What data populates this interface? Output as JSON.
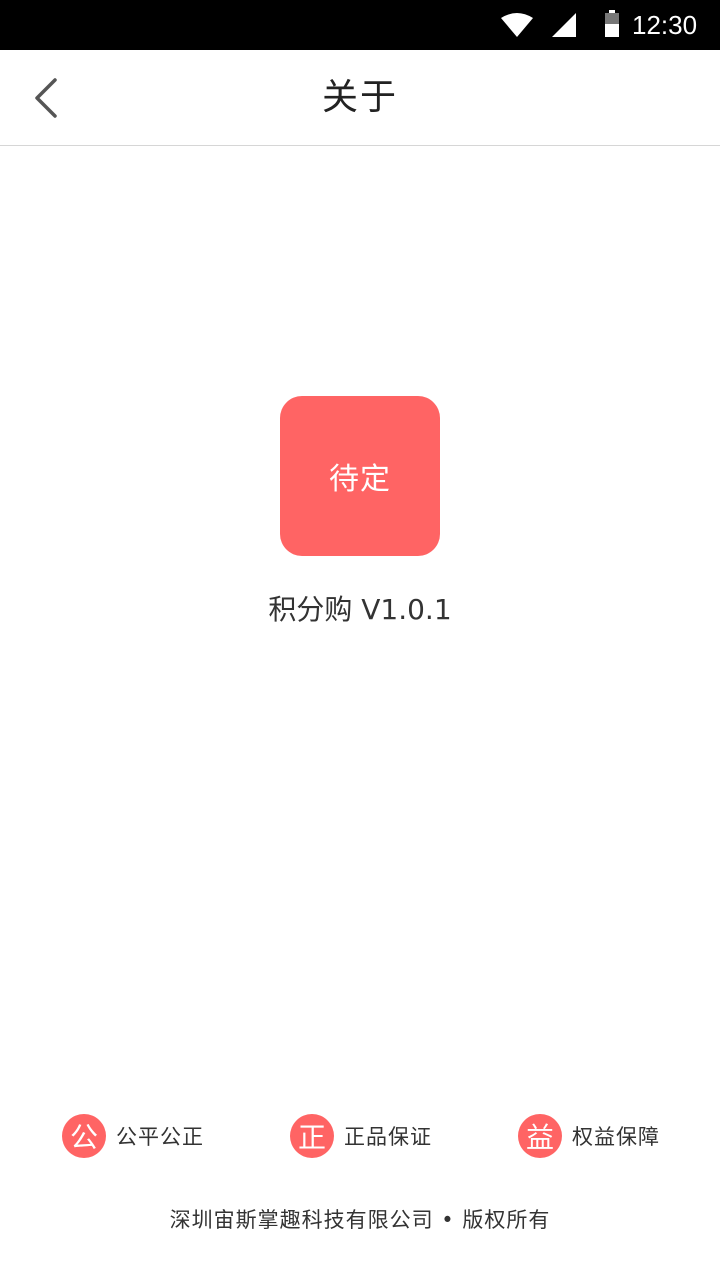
{
  "status_bar": {
    "time": "12:30",
    "icons": [
      "wifi-icon",
      "signal-icon",
      "battery-icon"
    ]
  },
  "header": {
    "back_icon": "chevron-left-icon",
    "title": "关于"
  },
  "app": {
    "logo_text": "待定",
    "version_text": "积分购  V1.0.1"
  },
  "features": [
    {
      "badge": "公",
      "label": "公平公正"
    },
    {
      "badge": "正",
      "label": "正品保证"
    },
    {
      "badge": "益",
      "label": "权益保障"
    }
  ],
  "footer": {
    "copyright": "深圳宙斯掌趣科技有限公司 • 版权所有"
  },
  "colors": {
    "accent": "#ff6464",
    "status_bar": "#000000",
    "text": "#333333",
    "divider": "#d6d6d6"
  }
}
